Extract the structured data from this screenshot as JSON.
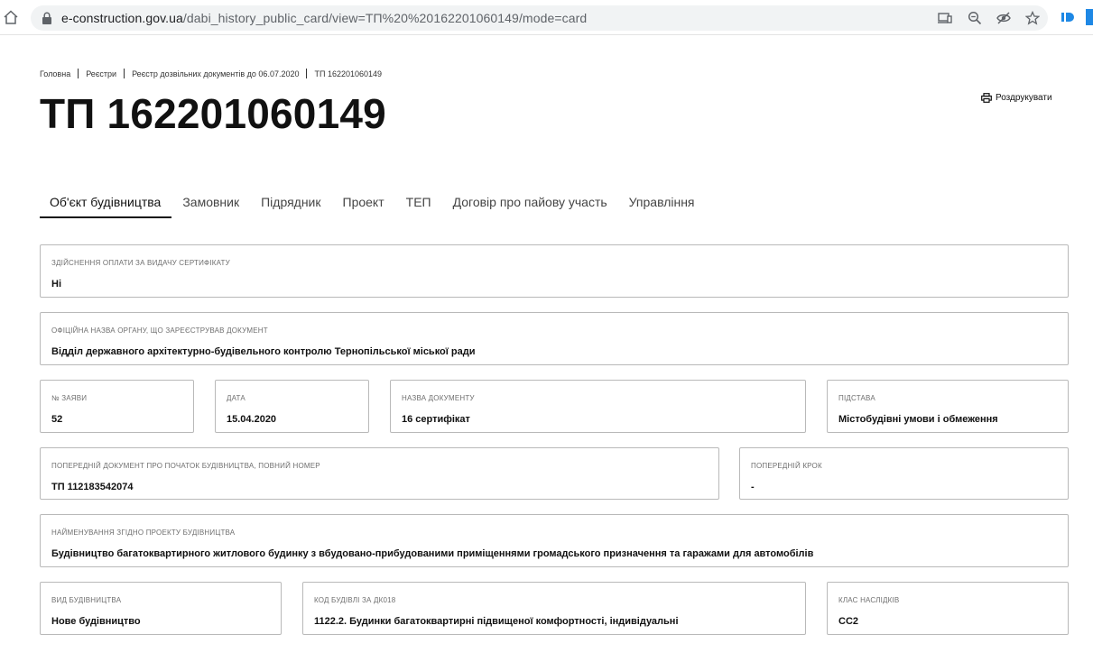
{
  "browser": {
    "url_host": "e-construction.gov.ua",
    "url_path": "/dabi_history_public_card/view=ТП%20%20162201060149/mode=card"
  },
  "breadcrumb": [
    "Головна",
    "Реєстри",
    "Реєстр дозвільних документів до 06.07.2020",
    "ТП 162201060149"
  ],
  "page": {
    "title": "ТП 162201060149",
    "print_label": "Роздрукувати"
  },
  "tabs": [
    "Об'єкт будівництва",
    "Замовник",
    "Підрядник",
    "Проект",
    "ТЕП",
    "Договір про пайову участь",
    "Управління"
  ],
  "fields": {
    "payment": {
      "label": "Здійснення оплати за видачу сертифікату",
      "value": "Ні"
    },
    "authority": {
      "label": "Офіційна назва органу, що зареєстрував документ",
      "value": "Відділ державного архітектурно-будівельного контролю Тернопільської міської ради"
    },
    "application_no": {
      "label": "№ заяви",
      "value": "52"
    },
    "date": {
      "label": "Дата",
      "value": "15.04.2020"
    },
    "doc_name": {
      "label": "Назва документу",
      "value": "16 сертифікат"
    },
    "basis": {
      "label": "Підстава",
      "value": "Містобудівні умови і обмеження"
    },
    "prev_doc": {
      "label": "Попередній документ про початок будівництва, повний номер",
      "value": "ТП 112183542074"
    },
    "prev_step": {
      "label": "Попередній крок",
      "value": "-"
    },
    "project_name": {
      "label": "Найменування згідно проекту будівництва",
      "value": "Будівництво багатоквартирного житлового будинку з вбудовано-прибудованими приміщеннями громадського призначення та гаражами для автомобілів"
    },
    "construction_type": {
      "label": "Вид будівництва",
      "value": "Нове будівництво"
    },
    "building_code": {
      "label": "Код будівлі за ДК018",
      "value": "1122.2. Будинки багатоквартирні підвищеної комфортності, індивідуальні"
    },
    "consequence_class": {
      "label": "Клас наслідків",
      "value": "СС2"
    }
  }
}
